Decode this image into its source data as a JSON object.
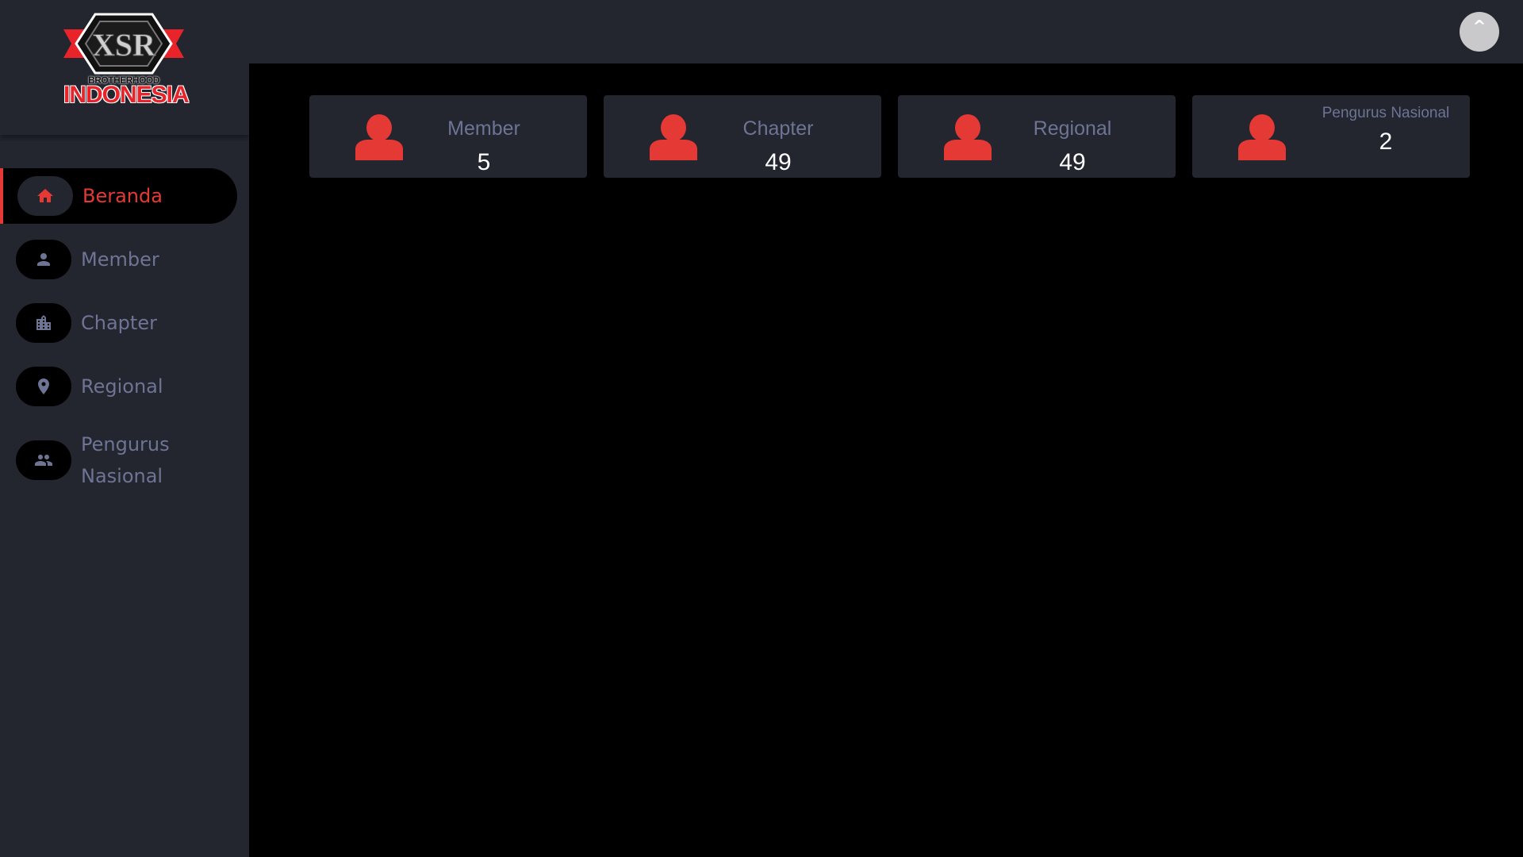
{
  "logo": {
    "line1": "BROTHERHOOD",
    "line2": "INDONESIA",
    "badge": "XSR"
  },
  "sidebar": {
    "items": [
      {
        "label": "Beranda",
        "icon": "home-icon"
      },
      {
        "label": "Member",
        "icon": "person-icon"
      },
      {
        "label": "Chapter",
        "icon": "building-icon"
      },
      {
        "label": "Regional",
        "icon": "location-pin-icon"
      },
      {
        "label": "Pengurus Nasional",
        "icon": "group-icon"
      }
    ]
  },
  "topbar": {
    "scroll_top_label": "^"
  },
  "stats": [
    {
      "title": "Member",
      "value": "5"
    },
    {
      "title": "Chapter",
      "value": "49"
    },
    {
      "title": "Regional",
      "value": "49"
    },
    {
      "title": "Pengurus Nasional",
      "value": "2"
    }
  ],
  "colors": {
    "accent": "#e53935",
    "sidebar_bg": "#23252f",
    "main_bg": "#000000",
    "muted_text": "#6e7493"
  }
}
